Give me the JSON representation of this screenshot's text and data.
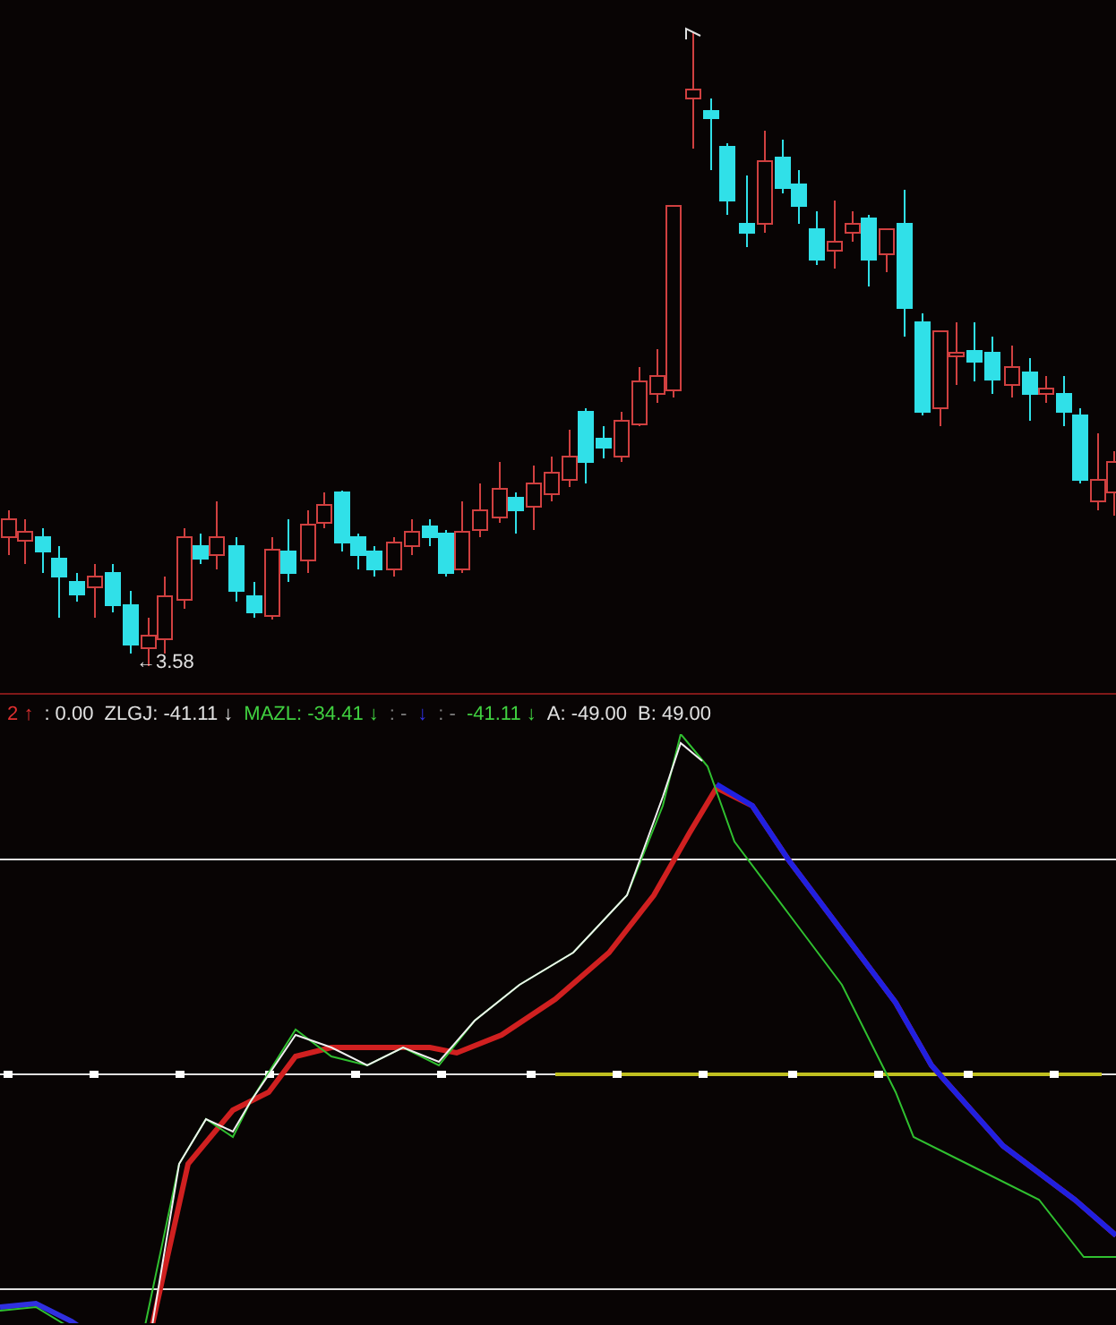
{
  "price_chart": {
    "low_label": "←3.58"
  },
  "indicator_legend": [
    {
      "text": "2",
      "arrow": "↑",
      "color": "#e03030"
    },
    {
      "text": ": 0.00",
      "color": "#e0e0e0"
    },
    {
      "text": "ZLGJ: -41.11",
      "arrow": "↓",
      "color": "#e0e0e0"
    },
    {
      "text": "MAZL: -34.41",
      "arrow": "↓",
      "color": "#40d040"
    },
    {
      "text": ": -",
      "color": "#808080"
    },
    {
      "arrow": "↓",
      "color": "#3030e0"
    },
    {
      "text": ": -",
      "color": "#808080"
    },
    {
      "text": "-41.11",
      "arrow": "↓",
      "color": "#40d040"
    },
    {
      "text": "A: -49.00",
      "color": "#e0e0e0"
    },
    {
      "text": "B: 49.00",
      "color": "#e0e0e0"
    }
  ]
}
